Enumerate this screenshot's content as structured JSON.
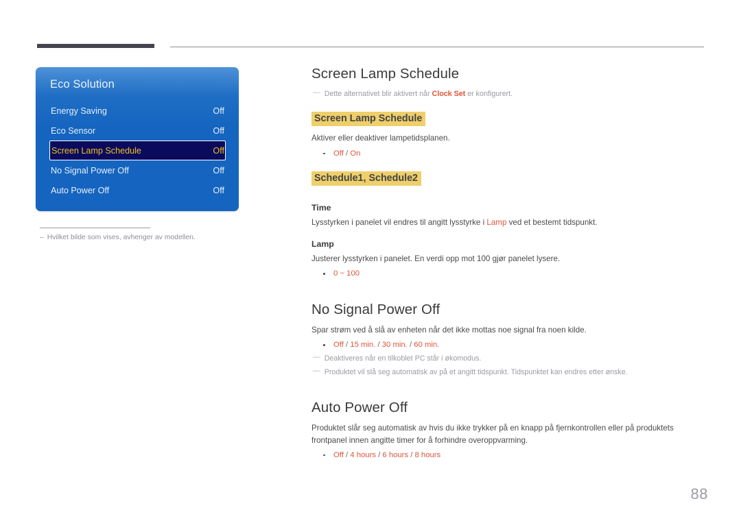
{
  "page": {
    "number": "88",
    "language": "nb-NO"
  },
  "header": {
    "rule_accent_color": "#45454f",
    "rule_line_color": "#8e8e96"
  },
  "osd_panel": {
    "title": "Eco Solution",
    "background_top_color": "#4f93d9",
    "background_bottom_color": "#1565c0",
    "selected_row_color": "#0b0b5e",
    "selected_text_color": "#f0c020",
    "rows": [
      {
        "label": "Energy Saving",
        "value": "Off",
        "selected": false
      },
      {
        "label": "Eco Sensor",
        "value": "Off",
        "selected": false
      },
      {
        "label": "Screen Lamp Schedule",
        "value": "Off",
        "selected": true
      },
      {
        "label": "No Signal Power Off",
        "value": "Off",
        "selected": false
      },
      {
        "label": "Auto Power Off",
        "value": "Off",
        "selected": false
      }
    ]
  },
  "left_note": {
    "dash": "–",
    "text": "Hvilket bilde som vises, avhenger av modellen."
  },
  "sections": {
    "screen_lamp_schedule": {
      "heading": "Screen Lamp Schedule",
      "note": {
        "dash": "—",
        "before": "Dette alternativet blir aktivert når ",
        "bold": "Clock Set",
        "after": " er konfigurert."
      },
      "sub_highlight": "Screen Lamp Schedule",
      "description": "Aktiver eller deaktiver lampetidsplanen.",
      "options": [
        {
          "a": "Off",
          "sep": " / ",
          "b": "On"
        }
      ]
    },
    "schedule": {
      "highlight": "Schedule1, Schedule2",
      "time": {
        "title": "Time",
        "before": "Lysstyrken i panelet vil endres til angitt lysstyrke i ",
        "accent": "Lamp",
        "after": " ved et bestemt tidspunkt."
      },
      "lamp": {
        "title": "Lamp",
        "description": "Justerer lysstyrken i panelet. En verdi opp mot 100 gjør panelet lysere.",
        "options": [
          {
            "a": "0 ~ 100",
            "sep": "",
            "b": ""
          }
        ]
      }
    },
    "no_signal_power_off": {
      "heading": "No Signal Power Off",
      "description": "Spar strøm ved å slå av enheten når det ikke mottas noe signal fra noen kilde.",
      "options_line": {
        "items": [
          "Off",
          "15 min.",
          "30 min.",
          "60 min."
        ],
        "separator": " / "
      },
      "notes": [
        {
          "dash": "—",
          "text": "Deaktiveres når en tilkoblet PC står i økomodus."
        },
        {
          "dash": "—",
          "text": "Produktet vil slå seg automatisk av på et angitt tidspunkt. Tidspunktet kan endres etter ønske."
        }
      ]
    },
    "auto_power_off": {
      "heading": "Auto Power Off",
      "description": "Produktet slår seg automatisk av hvis du ikke trykker på en knapp på fjernkontrollen eller på produktets frontpanel innen angitte timer for å forhindre overoppvarming.",
      "options_line": {
        "items": [
          "Off",
          "4 hours",
          "6 hours",
          "8 hours"
        ],
        "separator": " / "
      }
    }
  },
  "colors": {
    "accent_red": "#e0543a",
    "highlight_yellow": "#efcf6a",
    "heading_gray": "#3a3a3c",
    "note_gray": "#9b9ba3"
  }
}
